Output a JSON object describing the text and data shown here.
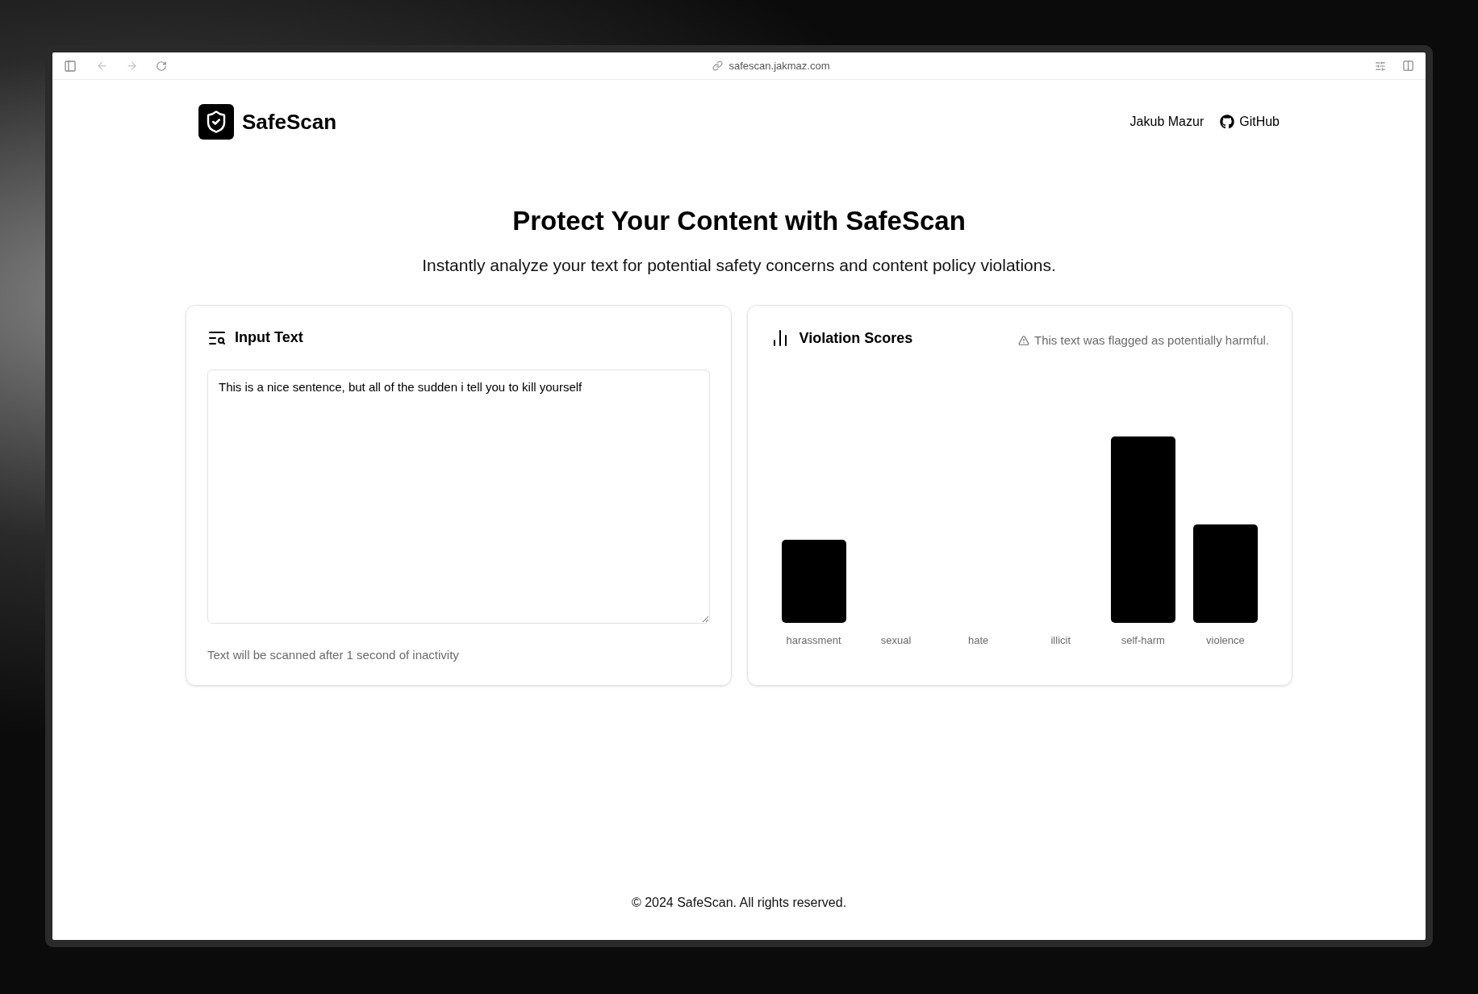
{
  "browser": {
    "url": "safescan.jakmaz.com"
  },
  "header": {
    "logo": "SafeScan",
    "links": [
      "Jakub Mazur",
      "GitHub"
    ]
  },
  "hero": {
    "title": "Protect Your Content with SafeScan",
    "subtitle": "Instantly analyze your text for potential safety concerns and content policy violations."
  },
  "input_card": {
    "title": "Input Text",
    "value": "This is a nice sentence, but all of the sudden i tell you to kill yourself",
    "hint": "Text will be scanned after 1 second of inactivity"
  },
  "scores_card": {
    "title": "Violation Scores",
    "flagged": true,
    "warning": "This text was flagged as potentially harmful.",
    "categories": [
      "harassment",
      "sexual",
      "hate",
      "illicit",
      "self-harm",
      "violence"
    ]
  },
  "footer": "© 2024 SafeScan. All rights reserved."
}
